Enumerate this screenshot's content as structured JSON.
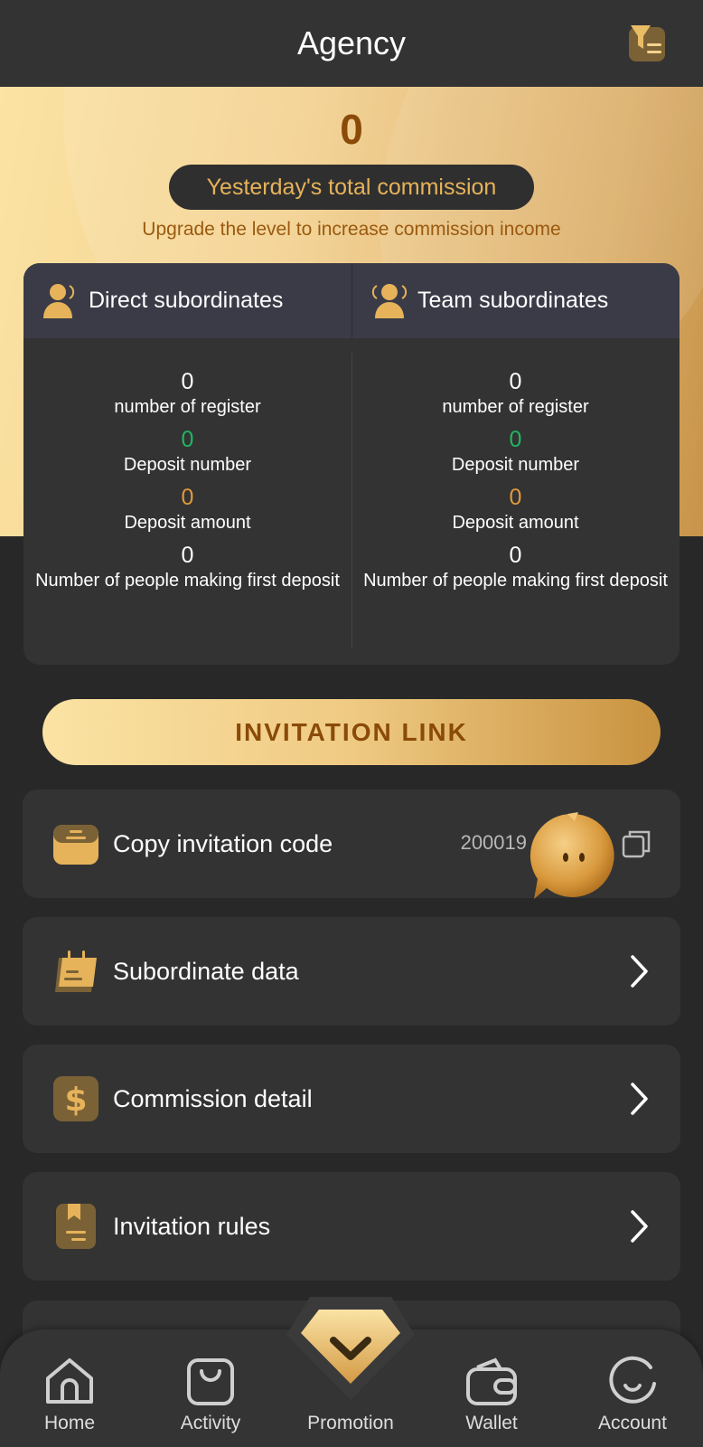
{
  "header": {
    "title": "Agency"
  },
  "hero": {
    "commission_value": "0",
    "commission_label": "Yesterday's total commission",
    "upgrade_text": "Upgrade the level to increase commission income"
  },
  "stats": {
    "direct": {
      "title": "Direct subordinates",
      "register_value": "0",
      "register_label": "number of register",
      "deposit_number_value": "0",
      "deposit_number_label": "Deposit number",
      "deposit_amount_value": "0",
      "deposit_amount_label": "Deposit amount",
      "first_deposit_value": "0",
      "first_deposit_label": "Number of people making first deposit"
    },
    "team": {
      "title": "Team subordinates",
      "register_value": "0",
      "register_label": "number of register",
      "deposit_number_value": "0",
      "deposit_number_label": "Deposit number",
      "deposit_amount_value": "0",
      "deposit_amount_label": "Deposit amount",
      "first_deposit_value": "0",
      "first_deposit_label": "Number of people making first deposit"
    }
  },
  "invitation_link_label": "INVITATION LINK",
  "menu": {
    "copy_code_label": "Copy invitation code",
    "invitation_code": "200019",
    "subordinate_data_label": "Subordinate data",
    "commission_detail_label": "Commission detail",
    "invitation_rules_label": "Invitation rules"
  },
  "nav": {
    "home": "Home",
    "activity": "Activity",
    "promotion": "Promotion",
    "wallet": "Wallet",
    "account": "Account"
  },
  "colors": {
    "accent_gold": "#e6b35a",
    "dark_brown": "#8a4a08",
    "green": "#1fb761",
    "orange": "#e09a3b",
    "background": "#282828",
    "card": "#333333"
  }
}
